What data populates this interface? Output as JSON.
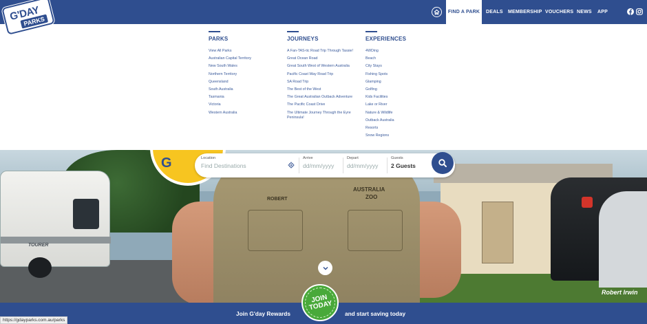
{
  "brand": {
    "logo_line1": "G'DAY",
    "logo_line2": "PARKS"
  },
  "header": {
    "nav": [
      {
        "label": "FIND A PARK",
        "active": true
      },
      {
        "label": "DEALS"
      },
      {
        "label": "MEMBERSHIP"
      },
      {
        "label": "VOUCHERS"
      },
      {
        "label": "NEWS"
      },
      {
        "label": "APP"
      }
    ],
    "icons": [
      "home-icon",
      "facebook-icon",
      "instagram-icon"
    ]
  },
  "dropdown": {
    "parks": {
      "heading": "PARKS",
      "items": [
        "View All Parks",
        "Australian Capital Territory",
        "New South Wales",
        "Northern Territory",
        "Queensland",
        "South Australia",
        "Tasmania",
        "Victoria",
        "Western Australia"
      ]
    },
    "journeys": {
      "heading": "JOURNEYS",
      "items": [
        "A Fan-TAS-tic Road Trip Through Tassie!",
        "Great Ocean Road",
        "Great South West of Western Australia",
        "Pacific Coast Way Road Trip",
        "SA Road Trip",
        "The Best of the West",
        "The Great Australian Outback Adventure",
        "The Pacific Coast Drive",
        "The Ultimate Journey Through the Eyre Peninsula!"
      ]
    },
    "experiences": {
      "heading": "EXPERIENCES",
      "items": [
        "4WDing",
        "Beach",
        "City Stays",
        "Fishing Spots",
        "Glamping",
        "Golfing",
        "Kids Facilities",
        "Lake or River",
        "Nature & Wildlife",
        "Outback Australia",
        "Resorts",
        "Snow Regions"
      ]
    }
  },
  "search": {
    "location_label": "Location",
    "location_placeholder": "Find Destinations",
    "arrive_label": "Arrive",
    "arrive_placeholder": "dd/mm/yyyy",
    "depart_label": "Depart",
    "depart_placeholder": "dd/mm/yyyy",
    "guests_label": "Guests",
    "guests_value": "2 Guests"
  },
  "hero": {
    "shirt_name": "ROBERT",
    "shirt_logo_line1": "AUSTRALIA",
    "shirt_logo_line2": "ZOO",
    "caravan_brand": "TOURER",
    "partial_logo_text": "G",
    "photo_credit": "Robert Irwin"
  },
  "banner": {
    "left_text": "Join G'day Rewards",
    "badge_text": "JOIN TODAY",
    "right_text": "and start saving today"
  },
  "status_bar": {
    "url": "https://gdayparks.com.au/parks"
  },
  "colors": {
    "brand_blue": "#2f4e8f",
    "accent_yellow": "#f7c520",
    "join_green": "#49a93a"
  }
}
